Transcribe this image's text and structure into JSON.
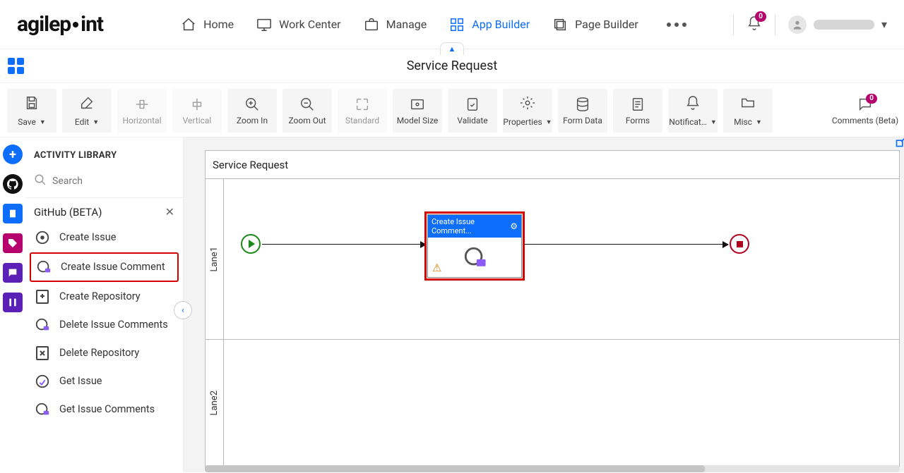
{
  "brand": "agilepoint",
  "nav": {
    "home": "Home",
    "work_center": "Work Center",
    "manage": "Manage",
    "app_builder": "App Builder",
    "page_builder": "Page Builder"
  },
  "bell_badge": "0",
  "page_title": "Service Request",
  "toolbar": {
    "save": "Save",
    "edit": "Edit",
    "horizontal": "Horizontal",
    "vertical": "Vertical",
    "zoom_in": "Zoom In",
    "zoom_out": "Zoom Out",
    "standard": "Standard",
    "model_size": "Model Size",
    "validate": "Validate",
    "properties": "Properties",
    "form_data": "Form Data",
    "forms": "Forms",
    "notifications": "Notificat…",
    "misc": "Misc",
    "comments": "Comments (Beta)",
    "comments_badge": "0"
  },
  "panel": {
    "title": "ACTIVITY LIBRARY",
    "search_placeholder": "Search",
    "group": "GitHub (BETA)",
    "items": {
      "create_issue": "Create Issue",
      "create_issue_comment": "Create Issue Comment",
      "create_repository": "Create Repository",
      "delete_issue_comments": "Delete Issue Comments",
      "delete_repository": "Delete Repository",
      "get_issue": "Get Issue",
      "get_issue_comments": "Get Issue Comments"
    }
  },
  "canvas": {
    "title": "Service Request",
    "lane1": "Lane1",
    "lane2": "Lane2",
    "task_label": "Create Issue Comment..."
  }
}
